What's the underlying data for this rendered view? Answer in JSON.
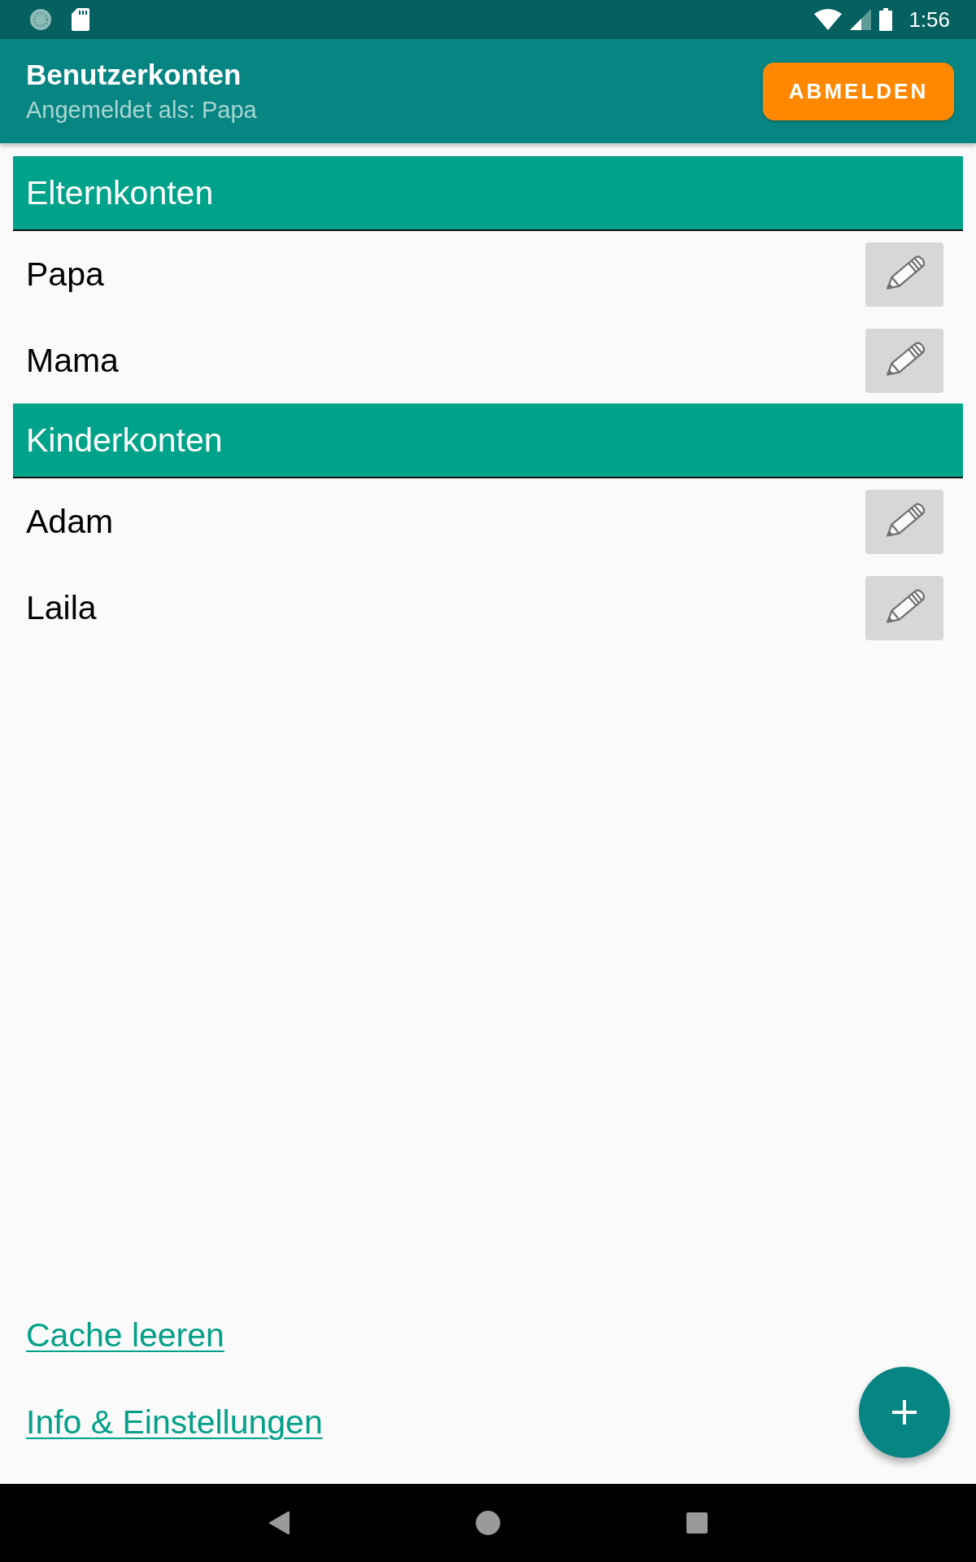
{
  "status_bar": {
    "time": "1:56"
  },
  "app_bar": {
    "title": "Benutzerkonten",
    "subtitle": "Angemeldet als: Papa",
    "action": "ABMELDEN"
  },
  "sections": [
    {
      "title": "Elternkonten",
      "accounts": [
        {
          "name": "Papa"
        },
        {
          "name": "Mama"
        }
      ]
    },
    {
      "title": "Kinderkonten",
      "accounts": [
        {
          "name": "Adam"
        },
        {
          "name": "Laila"
        }
      ]
    }
  ],
  "links": [
    "Cache leeren",
    "Info & Einstellungen"
  ]
}
